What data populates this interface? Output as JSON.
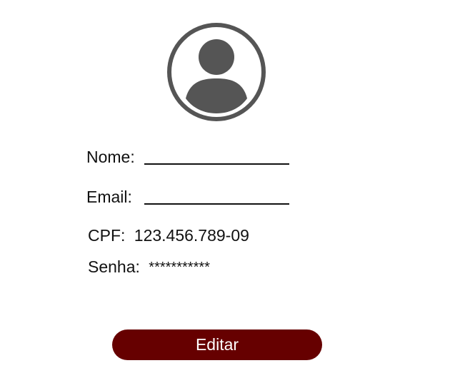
{
  "profile": {
    "avatar_icon": "user-circle-icon",
    "name_label": "Nome:",
    "name_value": "",
    "email_label": "Email:",
    "email_value": "",
    "cpf_label": "CPF:",
    "cpf_value": "123.456.789-09",
    "password_label": "Senha:",
    "password_value": "***********"
  },
  "actions": {
    "edit_label": "Editar"
  },
  "colors": {
    "accent": "#660000",
    "icon": "#555555"
  }
}
